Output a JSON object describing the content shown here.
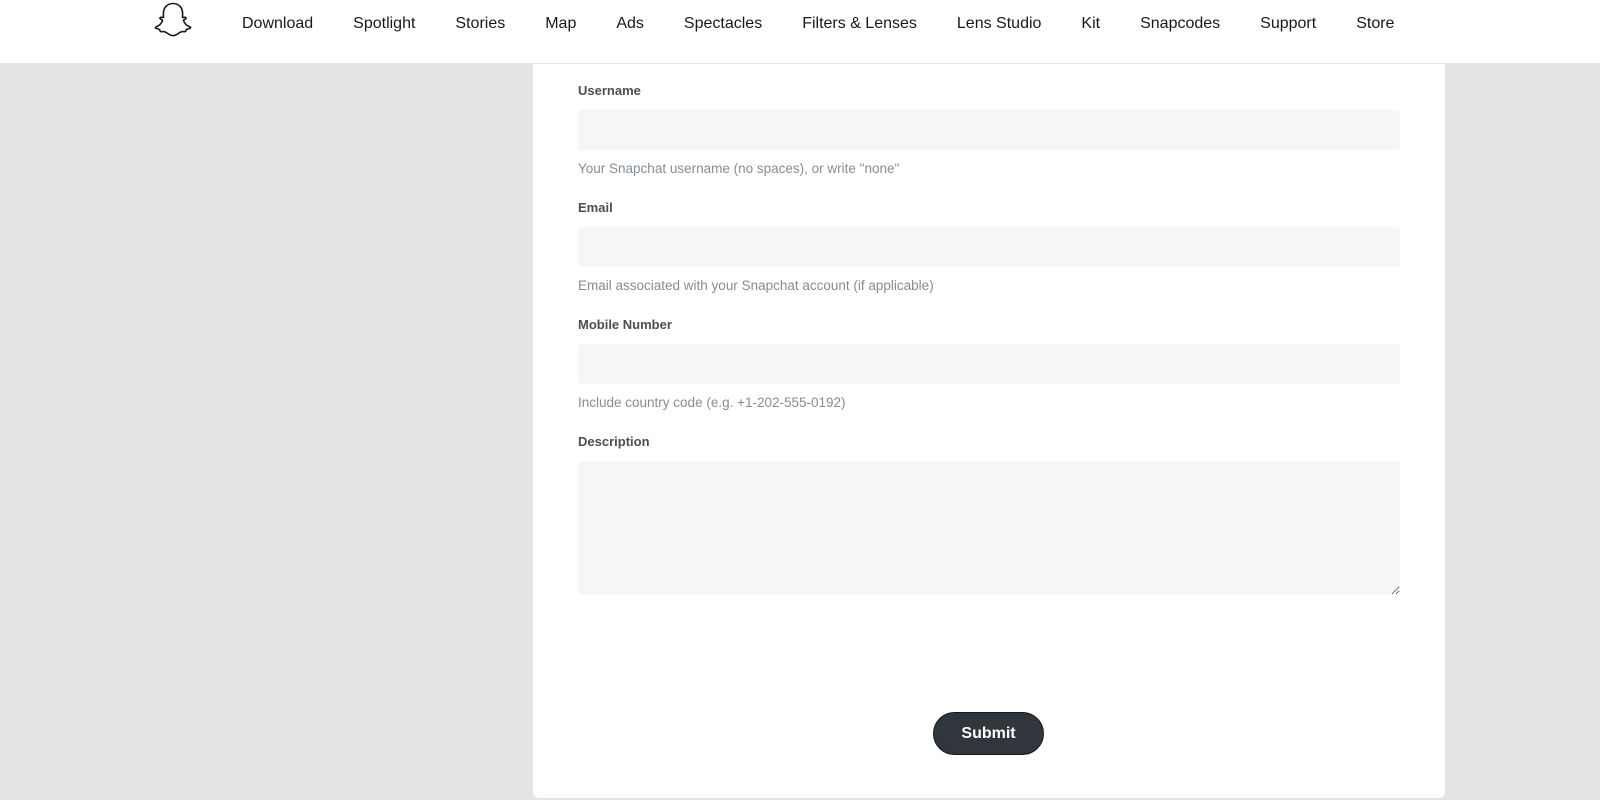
{
  "nav": {
    "logo_icon": "snapchat-ghost-icon",
    "items": [
      {
        "label": "Download"
      },
      {
        "label": "Spotlight"
      },
      {
        "label": "Stories"
      },
      {
        "label": "Map"
      },
      {
        "label": "Ads"
      },
      {
        "label": "Spectacles"
      },
      {
        "label": "Filters & Lenses"
      },
      {
        "label": "Lens Studio"
      },
      {
        "label": "Kit"
      },
      {
        "label": "Snapcodes"
      },
      {
        "label": "Support"
      },
      {
        "label": "Store"
      }
    ]
  },
  "form": {
    "username": {
      "label": "Username",
      "value": "",
      "hint": "Your Snapchat username (no spaces), or write \"none\""
    },
    "email": {
      "label": "Email",
      "value": "",
      "hint": "Email associated with your Snapchat account (if applicable)"
    },
    "mobile": {
      "label": "Mobile Number",
      "value": "",
      "hint": "Include country code (e.g. +1-202-555-0192)"
    },
    "description": {
      "label": "Description",
      "value": ""
    },
    "submit_label": "Submit"
  },
  "colors": {
    "page_background": "#e4e4e4",
    "card_background": "#ffffff",
    "input_background": "#f6f6f6",
    "button_background": "#31363c"
  }
}
